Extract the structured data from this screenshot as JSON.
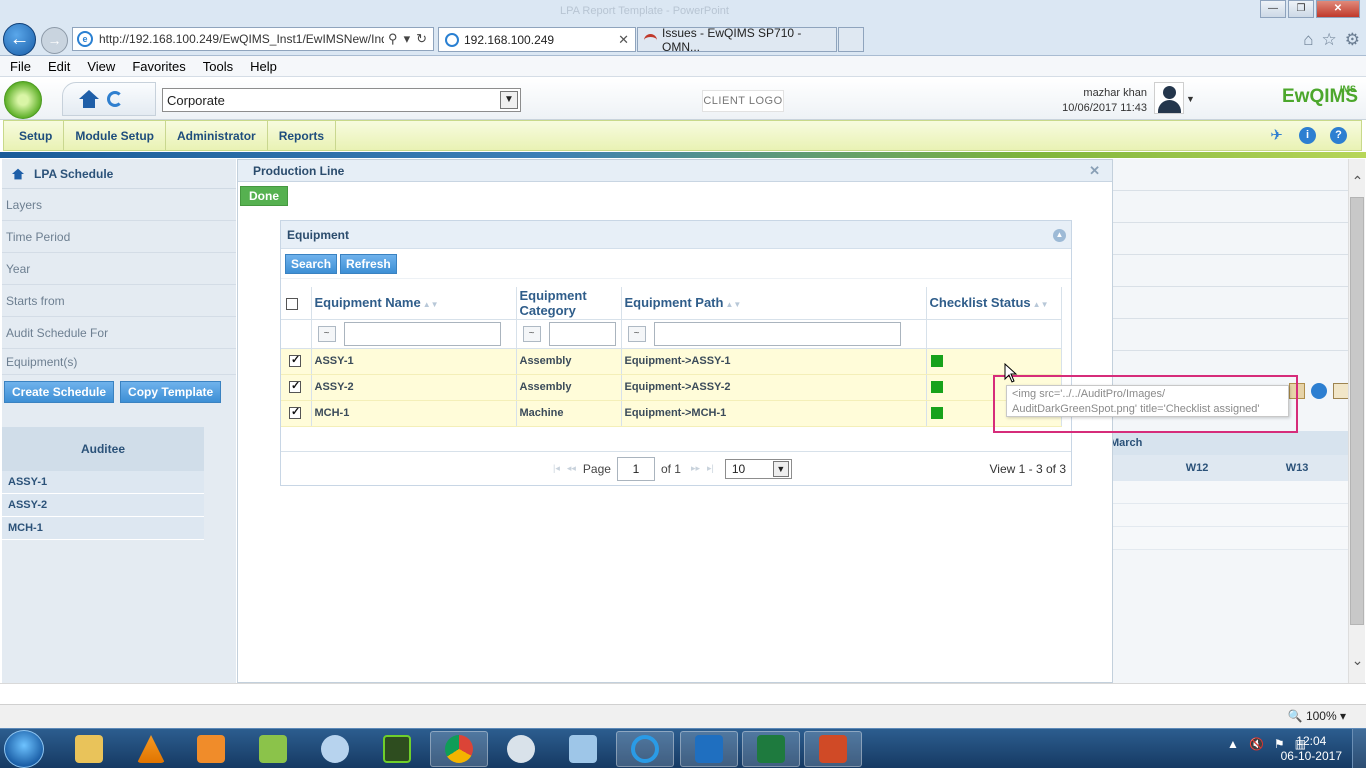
{
  "browser": {
    "window_title": "LPA Report Template - PowerPoint",
    "address_url": "http://192.168.100.249/EwQIMS_Inst1/EwIMSNew/Ind",
    "tabs": [
      {
        "label": "192.168.100.249"
      },
      {
        "label": "Issues - EwQIMS SP710 - OMN..."
      }
    ],
    "menu": [
      "File",
      "Edit",
      "View",
      "Favorites",
      "Tools",
      "Help"
    ],
    "zoom": "100%"
  },
  "app": {
    "company": "Corporate",
    "client_logo": "CLIENT LOGO",
    "user_name": "mazhar khan",
    "user_datetime": "10/06/2017 11:43",
    "brand": "EwQIMS",
    "brand_sup": "IMS",
    "nav": [
      "Setup",
      "Module Setup",
      "Administrator",
      "Reports"
    ]
  },
  "page": {
    "breadcrumb": "LPA Schedule",
    "fields": [
      "Layers",
      "Time Period",
      "Year",
      "Starts from",
      "Audit Schedule For",
      "Equipment(s)"
    ],
    "buttons": {
      "create": "Create Schedule",
      "copy": "Copy Template"
    },
    "auditee_header": "Auditee",
    "auditees": [
      "ASSY-1",
      "ASSY-2",
      "MCH-1"
    ],
    "month": "March",
    "weeks": [
      "W12",
      "W13"
    ]
  },
  "dialog": {
    "title": "Production Line",
    "done": "Done",
    "grid_caption": "Equipment",
    "toolbar": {
      "search": "Search",
      "refresh": "Refresh"
    },
    "columns": [
      "Equipment Name",
      "Equipment Category",
      "Equipment Path",
      "Checklist Status"
    ],
    "rows": [
      {
        "name": "ASSY-1",
        "category": "Assembly",
        "path": "Equipment->ASSY-1",
        "checked": true
      },
      {
        "name": "ASSY-2",
        "category": "Assembly",
        "path": "Equipment->ASSY-2",
        "checked": true
      },
      {
        "name": "MCH-1",
        "category": "Machine",
        "path": "Equipment->MCH-1",
        "checked": true
      }
    ],
    "pager": {
      "page_label": "Page",
      "page": "1",
      "of": "of 1",
      "page_size": "10",
      "view": "View 1 - 3 of 3"
    },
    "status_color": "#17a21b"
  },
  "tooltip": {
    "line1": "<img src='../../AuditPro/Images/",
    "line2": "AuditDarkGreenSpot.png'  title='Checklist assigned'"
  },
  "taskbar": {
    "time": "12:04",
    "date": "06-10-2017"
  }
}
